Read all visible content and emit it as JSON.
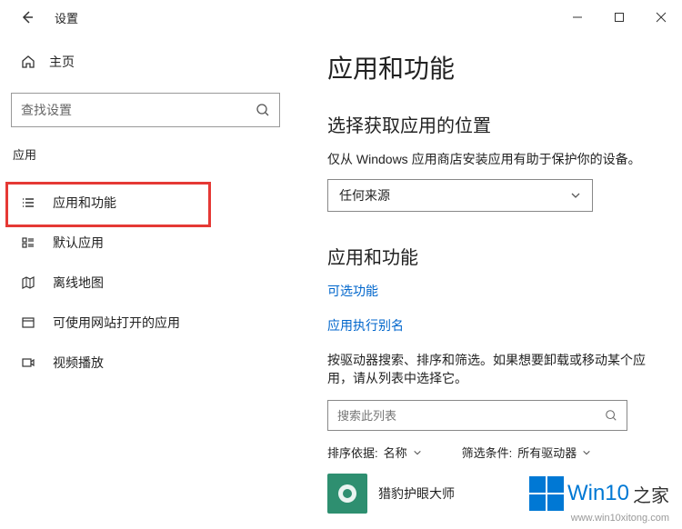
{
  "titlebar": {
    "title": "设置"
  },
  "sidebar": {
    "home_label": "主页",
    "search_placeholder": "查找设置",
    "section_label": "应用",
    "items": [
      {
        "label": "应用和功能"
      },
      {
        "label": "默认应用"
      },
      {
        "label": "离线地图"
      },
      {
        "label": "可使用网站打开的应用"
      },
      {
        "label": "视频播放"
      }
    ]
  },
  "main": {
    "page_title": "应用和功能",
    "source_section": {
      "heading": "选择获取应用的位置",
      "desc": "仅从 Windows 应用商店安装应用有助于保护你的设备。",
      "dropdown_value": "任何来源"
    },
    "apps_section": {
      "heading": "应用和功能",
      "link_optional": "可选功能",
      "link_alias": "应用执行别名",
      "desc": "按驱动器搜索、排序和筛选。如果想要卸载或移动某个应用，请从列表中选择它。",
      "search_placeholder": "搜索此列表",
      "sort_label": "排序依据:",
      "sort_value": "名称",
      "filter_label": "筛选条件:",
      "filter_value": "所有驱动器",
      "app_item": {
        "name": "猎豹护眼大师"
      }
    }
  },
  "watermark": {
    "brand": "Win10",
    "suffix": "之家",
    "url": "www.win10xitong.com"
  }
}
